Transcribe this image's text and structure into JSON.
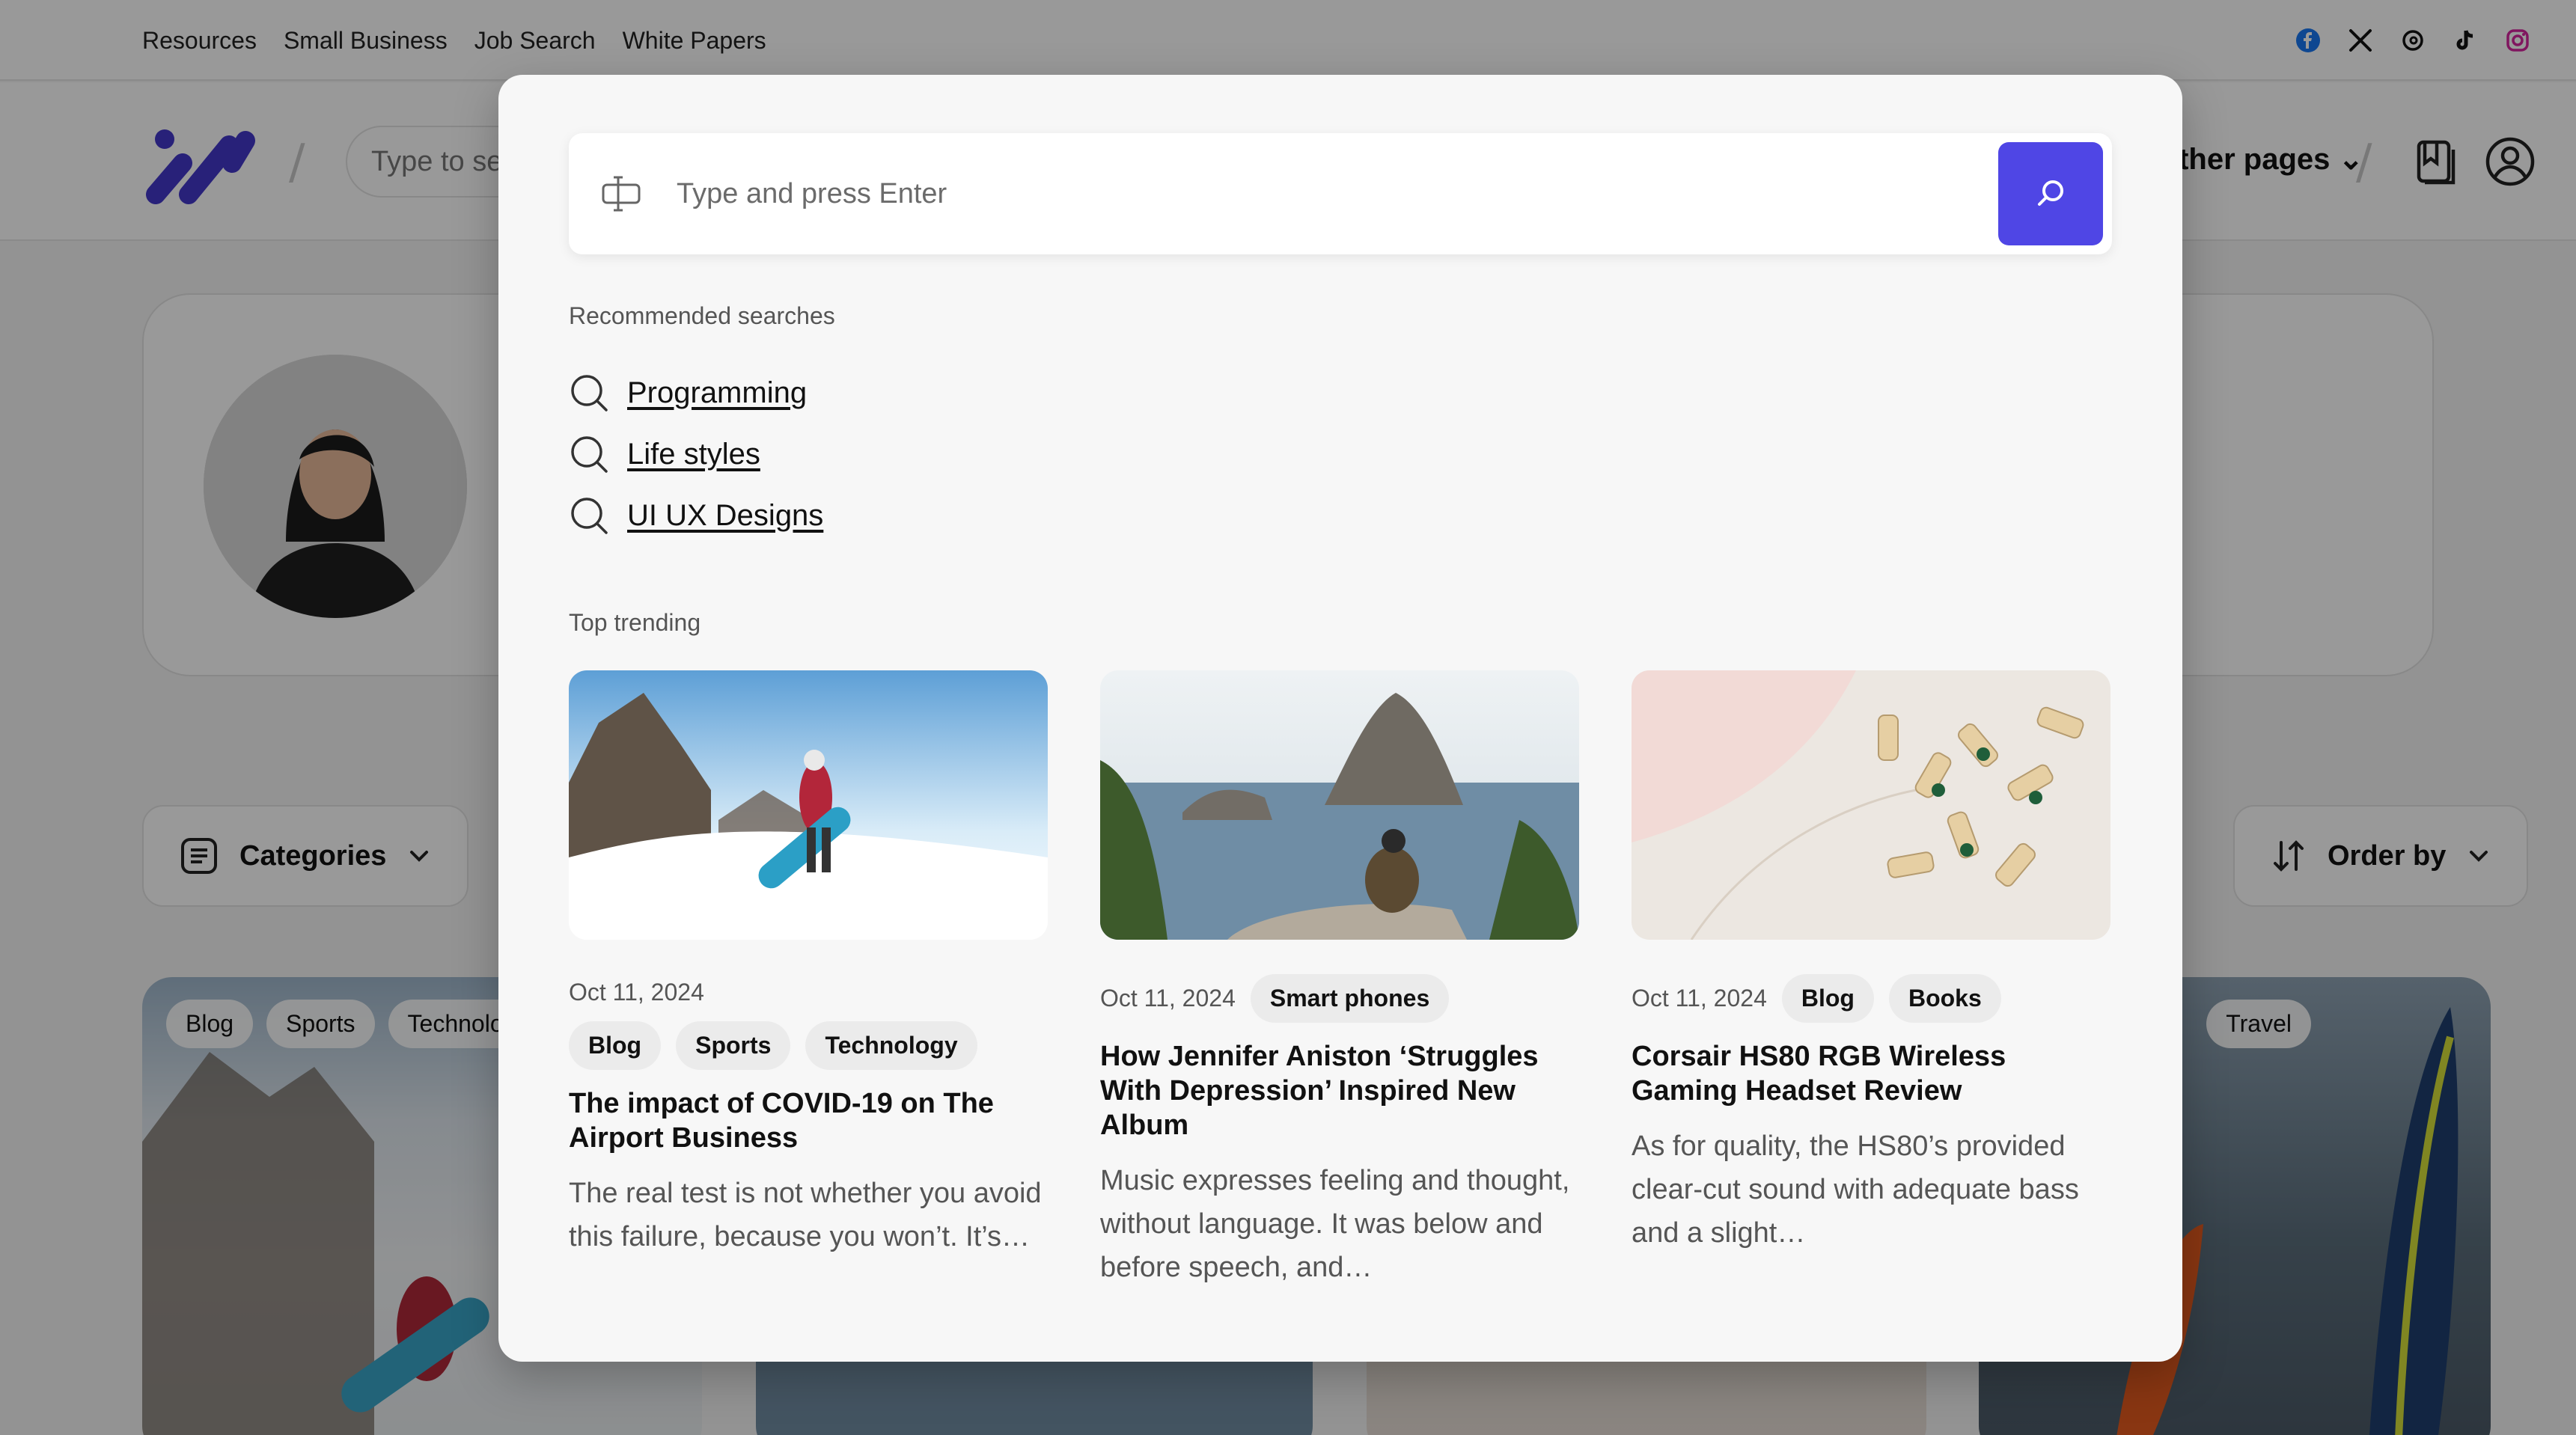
{
  "topbar": {
    "links": [
      "Resources",
      "Small Business",
      "Job Search",
      "White Papers"
    ],
    "social_icons": [
      "facebook-icon",
      "x-icon",
      "threads-icon",
      "tiktok-icon",
      "instagram-icon"
    ]
  },
  "header": {
    "search_placeholder": "Type to search",
    "other_pages_label": "Other pages"
  },
  "filters": {
    "categories_label": "Categories",
    "order_by_label": "Order by"
  },
  "background_posts": [
    {
      "tags": [
        "Blog",
        "Sports",
        "Technology"
      ]
    },
    {
      "tags": []
    },
    {
      "tags": []
    },
    {
      "tags": [
        "Travel"
      ]
    }
  ],
  "modal": {
    "search": {
      "placeholder": "Type and press Enter"
    },
    "recommended_label": "Recommended searches",
    "recommended": [
      "Programming",
      "Life styles",
      "UI UX Designs"
    ],
    "trending_label": "Top trending",
    "trending": [
      {
        "date": "Oct 11, 2024",
        "tags": [
          "Blog",
          "Sports",
          "Technology"
        ],
        "title": "The impact of COVID-19 on The Airport Business",
        "excerpt": "The real test is not whether you avoid this failure, because you won’t. It’s…"
      },
      {
        "date": "Oct 11, 2024",
        "tags": [
          "Smart phones"
        ],
        "title": "How Jennifer Aniston ‘Struggles With Depression’ Inspired New Album",
        "excerpt": "Music expresses feeling and thought, without language. It was below and before speech, and…"
      },
      {
        "date": "Oct 11, 2024",
        "tags": [
          "Blog",
          "Books"
        ],
        "title": "Corsair HS80 RGB Wireless Gaming Headset Review",
        "excerpt": "As for quality, the HS80’s provided clear-cut sound with adequate bass and a slight…"
      }
    ]
  },
  "colors": {
    "accent": "#4f46e5",
    "overlay": "rgba(0,0,0,0.40)"
  }
}
